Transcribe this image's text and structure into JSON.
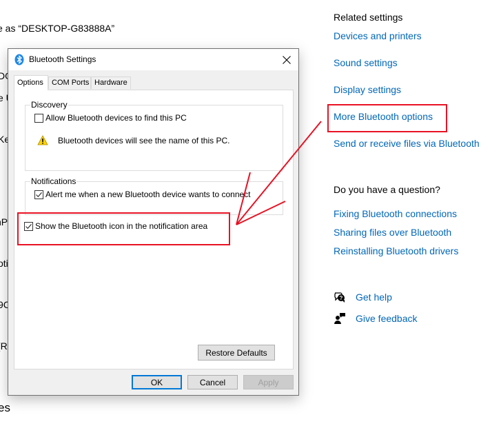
{
  "background": {
    "device_name_text": "e as “DESKTOP-G83888A”",
    "clipped_fragments": [
      "DO",
      "e U",
      "Ke",
      "nP",
      "oti",
      "9C",
      "(Re",
      "es"
    ]
  },
  "right_panel": {
    "related_heading": "Related settings",
    "related_links": [
      "Devices and printers",
      "Sound settings",
      "Display settings",
      "More Bluetooth options",
      "Send or receive files via Bluetooth"
    ],
    "question_heading": "Do you have a question?",
    "question_links": [
      "Fixing Bluetooth connections",
      "Sharing files over Bluetooth",
      "Reinstalling Bluetooth drivers"
    ],
    "help_links": [
      {
        "label": "Get help",
        "icon": "help-chat-icon"
      },
      {
        "label": "Give feedback",
        "icon": "feedback-icon"
      }
    ],
    "link_color": "#0067b8"
  },
  "dialog": {
    "title": "Bluetooth Settings",
    "title_icon": "bluetooth-icon",
    "tabs": [
      {
        "label": "Options",
        "active": true
      },
      {
        "label": "COM Ports",
        "active": false
      },
      {
        "label": "Hardware",
        "active": false
      }
    ],
    "discovery": {
      "label": "Discovery",
      "allow_find": {
        "label": "Allow Bluetooth devices to find this PC",
        "checked": false
      },
      "warning": "Bluetooth devices will see the name of this PC."
    },
    "notifications": {
      "label": "Notifications",
      "alert_connect": {
        "label": "Alert me when a new Bluetooth device wants to connect",
        "checked": true
      }
    },
    "show_icon": {
      "label": "Show the Bluetooth icon in the notification area",
      "checked": true
    },
    "restore_defaults": "Restore Defaults",
    "buttons": {
      "ok": "OK",
      "cancel": "Cancel",
      "apply": "Apply"
    }
  },
  "annotation_color": "#e81123"
}
